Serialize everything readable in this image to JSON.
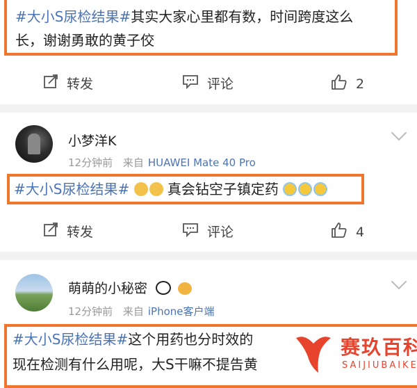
{
  "post1": {
    "tag": "#大小S尿检结果#",
    "line1_rest": "其实大家心里都有数，时间跨度这么",
    "line2": "长，谢谢勇敢的黄子佼",
    "actions": {
      "repost": "转发",
      "comment": "评论",
      "like_count": "2"
    }
  },
  "post2": {
    "username": "小梦洋K",
    "time": "12分钟前",
    "from": "来自",
    "source": "HUAWEI Mate 40 Pro",
    "tag": "#大小S尿检结果#",
    "text": "真会钻空子镇定药",
    "actions": {
      "repost": "转发",
      "comment": "评论",
      "like_count": "4"
    }
  },
  "post3": {
    "username": "萌萌的小秘密",
    "time": "12分钟前",
    "from": "来自",
    "source": "iPhone客户端",
    "tag": "#大小S尿检结果#",
    "line1_rest": "这个用药也分时效的",
    "line2": "现在检测有什么用呢，大S干嘛不提告黄"
  },
  "watermark": {
    "name": "赛玖百科",
    "pinyin": "SAIJIUBAIKE"
  },
  "colors": {
    "highlight": "#f0752e",
    "link": "#4b74b7",
    "watermark": "#e8432d"
  }
}
